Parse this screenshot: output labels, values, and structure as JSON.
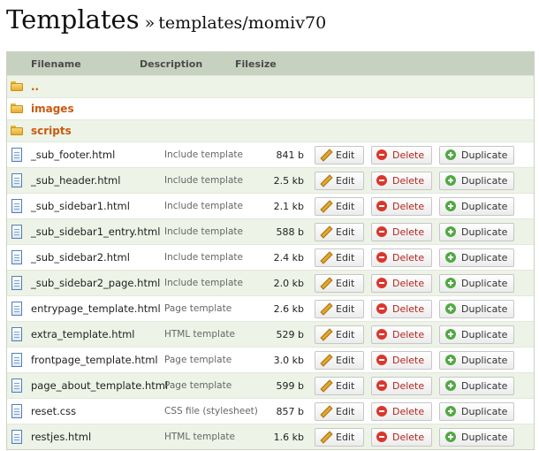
{
  "header": {
    "title": "Templates",
    "separator": "»",
    "path": "templates/momiv70"
  },
  "table": {
    "columns": {
      "filename": "Filename",
      "description": "Description",
      "filesize": "Filesize"
    },
    "dirs": [
      {
        "name": ".."
      },
      {
        "name": "images"
      },
      {
        "name": "scripts"
      }
    ],
    "files": [
      {
        "name": "_sub_footer.html",
        "description": "Include template",
        "size": "841 b"
      },
      {
        "name": "_sub_header.html",
        "description": "Include template",
        "size": "2.5 kb"
      },
      {
        "name": "_sub_sidebar1.html",
        "description": "Include template",
        "size": "2.1 kb"
      },
      {
        "name": "_sub_sidebar1_entry.html",
        "description": "Include template",
        "size": "588 b"
      },
      {
        "name": "_sub_sidebar2.html",
        "description": "Include template",
        "size": "2.4 kb"
      },
      {
        "name": "_sub_sidebar2_page.html",
        "description": "Include template",
        "size": "2.0 kb"
      },
      {
        "name": "entrypage_template.html",
        "description": "Page template",
        "size": "2.6 kb"
      },
      {
        "name": "extra_template.html",
        "description": "HTML template",
        "size": "529 b"
      },
      {
        "name": "frontpage_template.html",
        "description": "Page template",
        "size": "3.0 kb"
      },
      {
        "name": "page_about_template.html",
        "description": "Page template",
        "size": "599 b"
      },
      {
        "name": "reset.css",
        "description": "CSS file (stylesheet)",
        "size": "857 b"
      },
      {
        "name": "restjes.html",
        "description": "HTML template",
        "size": "1.6 kb"
      }
    ]
  },
  "actions": {
    "edit": "Edit",
    "delete": "Delete",
    "duplicate": "Duplicate"
  },
  "colors": {
    "header_bg": "#c7d1c0",
    "row_alt": "#edf3e6",
    "dir_link": "#c85a10",
    "delete_text": "#b3261e"
  }
}
